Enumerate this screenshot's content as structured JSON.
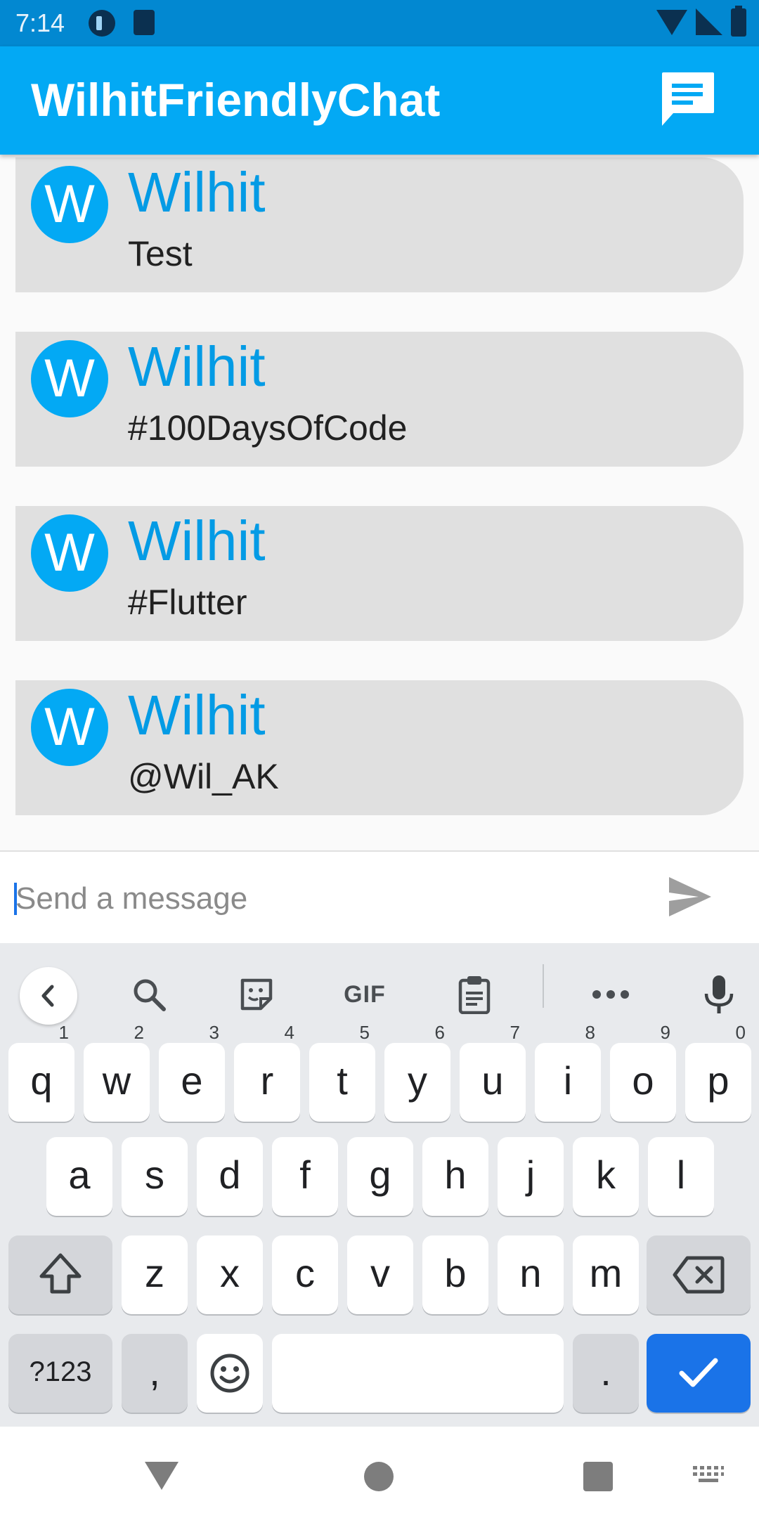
{
  "status_bar": {
    "time": "7:14"
  },
  "app_bar": {
    "title": "WilhitFriendlyChat",
    "action_icon": "chat-icon"
  },
  "messages": [
    {
      "avatar": "W",
      "name": "Wilhit",
      "text": "Test"
    },
    {
      "avatar": "W",
      "name": "Wilhit",
      "text": "#100DaysOfCode"
    },
    {
      "avatar": "W",
      "name": "Wilhit",
      "text": "#Flutter"
    },
    {
      "avatar": "W",
      "name": "Wilhit",
      "text": "@Wil_AK"
    }
  ],
  "compose": {
    "placeholder": "Send a message",
    "value": "",
    "send_icon": "send-icon"
  },
  "keyboard": {
    "toolbar": {
      "gif_label": "GIF"
    },
    "row1": [
      {
        "label": "q",
        "hint": "1"
      },
      {
        "label": "w",
        "hint": "2"
      },
      {
        "label": "e",
        "hint": "3"
      },
      {
        "label": "r",
        "hint": "4"
      },
      {
        "label": "t",
        "hint": "5"
      },
      {
        "label": "y",
        "hint": "6"
      },
      {
        "label": "u",
        "hint": "7"
      },
      {
        "label": "i",
        "hint": "8"
      },
      {
        "label": "o",
        "hint": "9"
      },
      {
        "label": "p",
        "hint": "0"
      }
    ],
    "row2": [
      "a",
      "s",
      "d",
      "f",
      "g",
      "h",
      "j",
      "k",
      "l"
    ],
    "row3": [
      "z",
      "x",
      "c",
      "v",
      "b",
      "n",
      "m"
    ],
    "row4": {
      "symbols": "?123",
      "comma": ",",
      "period": "."
    }
  },
  "colors": {
    "status_bar": "#0288d1",
    "app_bar": "#03a9f4",
    "name": "#039be5",
    "bubble": "#e0e0e0",
    "enter_key": "#1a73e8"
  }
}
